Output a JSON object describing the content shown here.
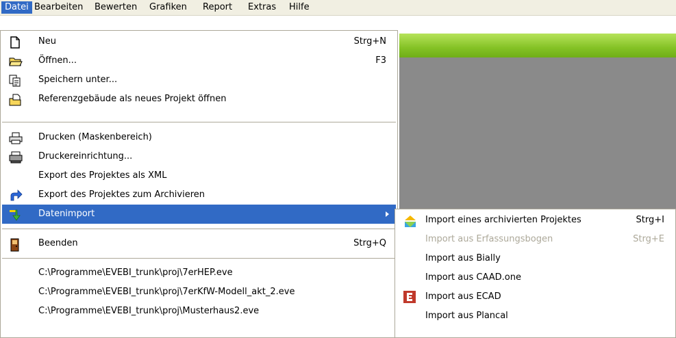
{
  "menubar": {
    "items": [
      {
        "label": "Datei"
      },
      {
        "label": "Bearbeiten"
      },
      {
        "label": "Bewerten"
      },
      {
        "label": "Grafiken"
      },
      {
        "label": "Report"
      },
      {
        "label": "Extras"
      },
      {
        "label": "Hilfe"
      }
    ]
  },
  "file_menu": {
    "neu": {
      "label": "Neu",
      "shortcut": "Strg+N"
    },
    "oeffnen": {
      "label": "Öffnen...",
      "shortcut": "F3"
    },
    "speichern_unter": {
      "label": "Speichern unter..."
    },
    "referenz": {
      "label": "Referenzgebäude als neues Projekt öffnen"
    },
    "drucken": {
      "label": "Drucken (Maskenbereich)"
    },
    "druckereinrichtung": {
      "label": "Druckereinrichtung..."
    },
    "export_xml": {
      "label": "Export des Projektes als XML"
    },
    "export_archiv": {
      "label": "Export des Projektes zum Archivieren"
    },
    "datenimport": {
      "label": "Datenimport"
    },
    "beenden": {
      "label": "Beenden",
      "shortcut": "Strg+Q"
    },
    "recent": [
      "C:\\Programme\\EVEBI_trunk\\proj\\7erHEP.eve",
      "C:\\Programme\\EVEBI_trunk\\proj\\7erKfW-Modell_akt_2.eve",
      "C:\\Programme\\EVEBI_trunk\\proj\\Musterhaus2.eve"
    ]
  },
  "import_submenu": {
    "archiv": {
      "label": "Import eines archivierten Projektes",
      "shortcut": "Strg+I"
    },
    "erfassung": {
      "label": "Import aus Erfassungsbogen",
      "shortcut": "Strg+E"
    },
    "bially": {
      "label": "Import aus Bially"
    },
    "caad": {
      "label": "Import aus CAAD.one"
    },
    "ecad": {
      "label": "Import aus ECAD"
    },
    "plancal": {
      "label": "Import aus Plancal"
    }
  },
  "colors": {
    "highlight": "#316ac5",
    "menubar": "#f1efe2",
    "green_accent": "#84c225",
    "panel_gray": "#8a8a8a",
    "disabled_text": "#aca899"
  },
  "icons": {
    "neu": "new-document-icon",
    "oeffnen": "open-folder-icon",
    "speichern": "save-as-icon",
    "referenz": "reference-building-icon",
    "drucken": "printer-icon",
    "druckereinrichtung": "printer-setup-icon",
    "export_archiv": "export-arrow-icon",
    "datenimport": "import-arrow-icon",
    "beenden": "exit-door-icon",
    "archiv": "archive-import-icon",
    "ecad": "ecad-logo-icon"
  }
}
